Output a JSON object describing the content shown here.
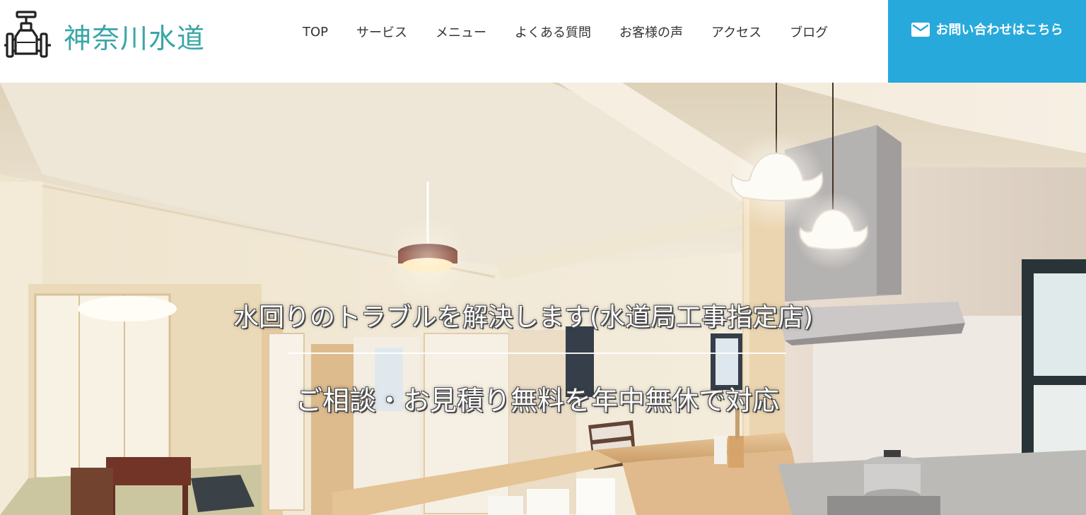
{
  "header": {
    "logo_text": "神奈川水道",
    "nav": [
      {
        "label": "TOP"
      },
      {
        "label": "サービス"
      },
      {
        "label": "メニュー"
      },
      {
        "label": "よくある質問"
      },
      {
        "label": "お客様の声"
      },
      {
        "label": "アクセス"
      },
      {
        "label": "ブログ"
      }
    ],
    "contact_label": "お問い合わせはこちら",
    "contact_icon": "mail-icon"
  },
  "hero": {
    "title": "水回りのトラブルを解決します(水道局工事指定店)",
    "subtitle": "ご相談・お見積り無料を年中無休で対応",
    "image": "kitchen-dining-interior-photo"
  },
  "colors": {
    "brand_teal": "#3aa6a8",
    "contact_blue": "#27a9dc",
    "nav_text": "#333333"
  }
}
